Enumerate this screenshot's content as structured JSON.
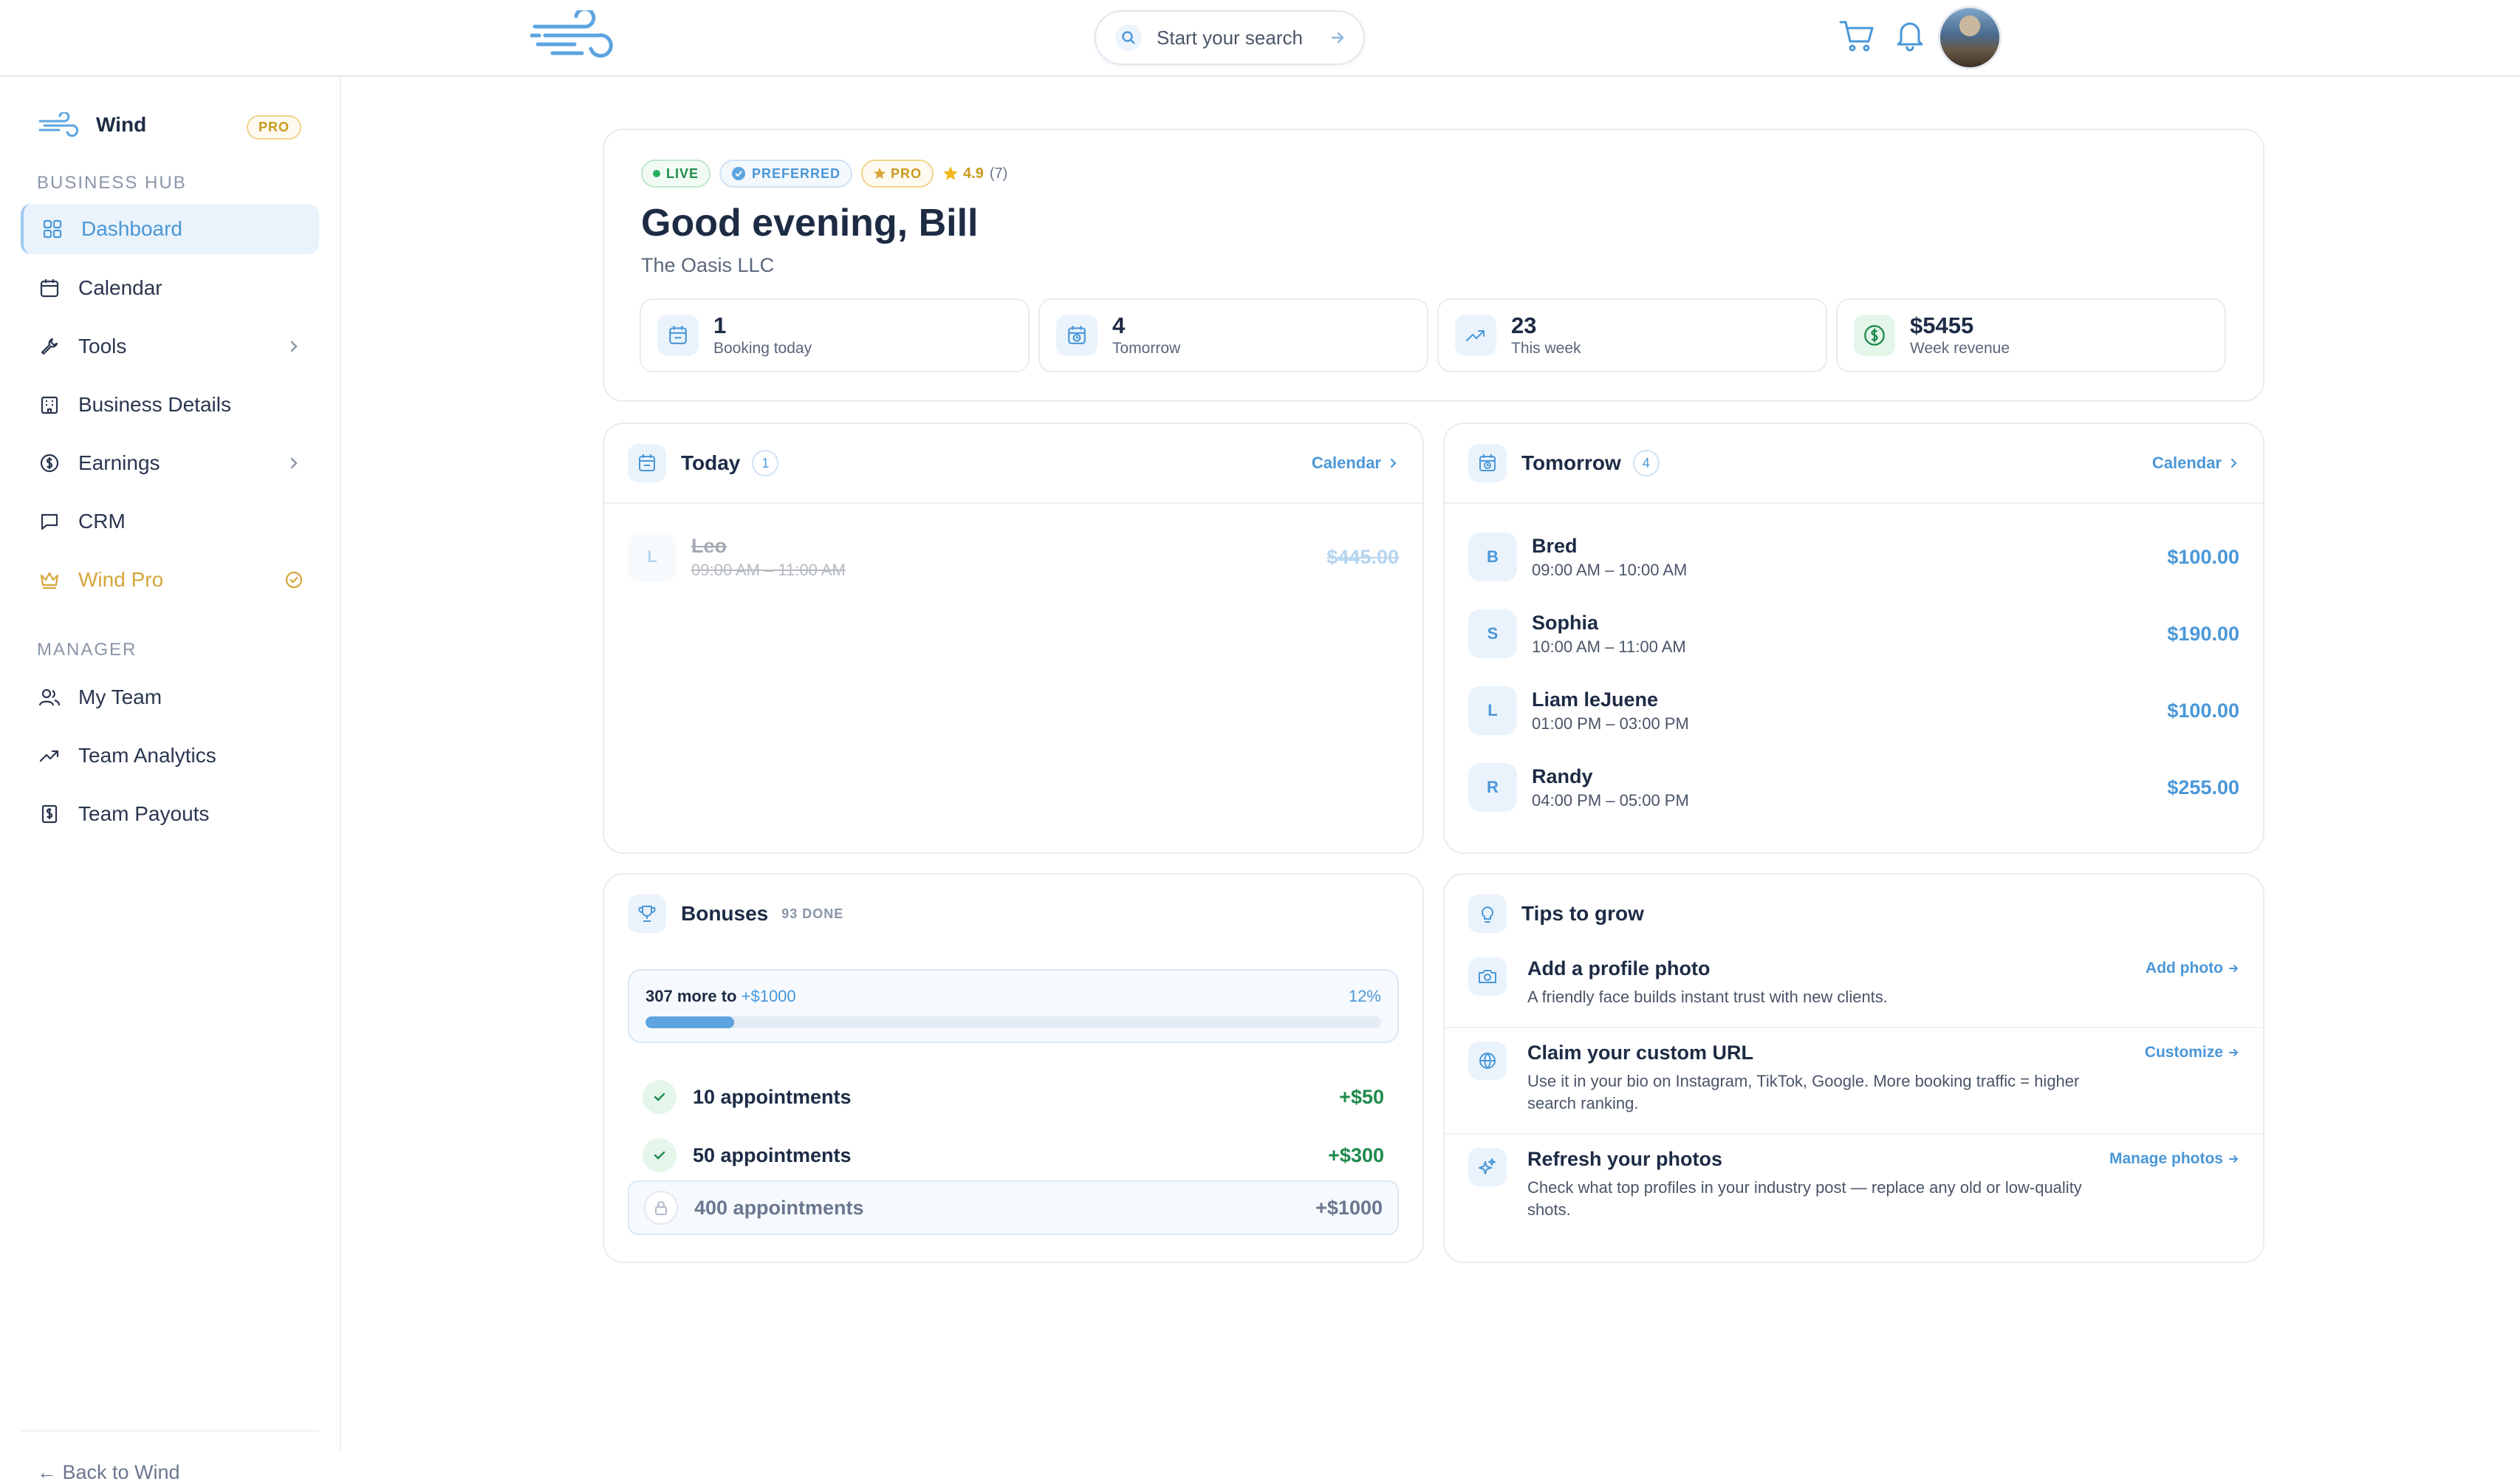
{
  "topbar": {
    "search_placeholder": "Start your search"
  },
  "sidebar": {
    "brand_name": "Wind",
    "brand_badge": "PRO",
    "section_business": "BUSINESS HUB",
    "section_manager": "MANAGER",
    "items": [
      {
        "label": "Dashboard",
        "icon": "grid-icon"
      },
      {
        "label": "Calendar",
        "icon": "calendar-icon"
      },
      {
        "label": "Tools",
        "icon": "wrench-icon"
      },
      {
        "label": "Business Details",
        "icon": "building-icon"
      },
      {
        "label": "Earnings",
        "icon": "dollar-icon"
      },
      {
        "label": "CRM",
        "icon": "chat-icon"
      },
      {
        "label": "Wind Pro",
        "icon": "crown-icon"
      }
    ],
    "manager_items": [
      {
        "label": "My Team",
        "icon": "users-icon"
      },
      {
        "label": "Team Analytics",
        "icon": "trend-icon"
      },
      {
        "label": "Team Payouts",
        "icon": "receipt-icon"
      }
    ],
    "back_label": "← Back to Wind"
  },
  "hero": {
    "badge_live": "LIVE",
    "badge_preferred": "PREFERRED",
    "badge_pro": "PRO",
    "rating": "4.9",
    "rating_count": "(7)",
    "greeting": "Good evening, Bill",
    "company": "The Oasis LLC",
    "stats": [
      {
        "value": "1",
        "label": "Booking today"
      },
      {
        "value": "4",
        "label": "Tomorrow"
      },
      {
        "value": "23",
        "label": "This week"
      },
      {
        "value": "$5455",
        "label": "Week revenue"
      }
    ]
  },
  "today": {
    "title": "Today",
    "count": "1",
    "link": "Calendar",
    "appointments": [
      {
        "initial": "L",
        "name": "Leo",
        "time": "09:00 AM – 11:00 AM",
        "price": "$445.00",
        "cancelled": true
      }
    ]
  },
  "tomorrow": {
    "title": "Tomorrow",
    "count": "4",
    "link": "Calendar",
    "appointments": [
      {
        "initial": "B",
        "name": "Bred",
        "time": "09:00 AM – 10:00 AM",
        "price": "$100.00"
      },
      {
        "initial": "S",
        "name": "Sophia",
        "time": "10:00 AM – 11:00 AM",
        "price": "$190.00"
      },
      {
        "initial": "L",
        "name": "Liam leJuene",
        "time": "01:00 PM – 03:00 PM",
        "price": "$100.00"
      },
      {
        "initial": "R",
        "name": "Randy",
        "time": "04:00 PM – 05:00 PM",
        "price": "$255.00"
      }
    ]
  },
  "bonuses": {
    "title": "Bonuses",
    "done": "93 DONE",
    "progress_text": "307 more to",
    "progress_target": "+$1000",
    "progress_pct": "12%",
    "progress_value": 0.12,
    "items": [
      {
        "label": "10 appointments",
        "value": "+$50",
        "state": "done"
      },
      {
        "label": "50 appointments",
        "value": "+$300",
        "state": "done"
      },
      {
        "label": "400 appointments",
        "value": "+$1000",
        "state": "locked"
      }
    ]
  },
  "tips": {
    "title": "Tips to grow",
    "items": [
      {
        "title": "Add a profile photo",
        "desc": "A friendly face builds instant trust with new clients.",
        "link": "Add photo"
      },
      {
        "title": "Claim your custom URL",
        "desc": "Use it in your bio on Instagram, TikTok, Google. More booking traffic = higher search ranking.",
        "link": "Customize"
      },
      {
        "title": "Refresh your photos",
        "desc": "Check what top profiles in your industry post — replace any old or low-quality shots.",
        "link": "Manage photos"
      }
    ]
  },
  "colors": {
    "accent": "#4a97d8",
    "gold": "#d6a53a",
    "green": "#1f8a4c"
  }
}
